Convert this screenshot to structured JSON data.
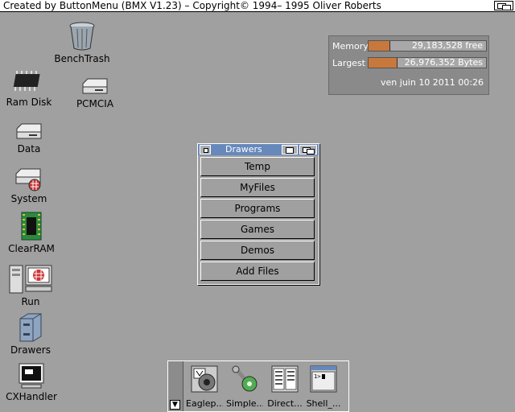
{
  "titlebar": {
    "text": "Created by ButtonMenu (BMX V1.23) – Copyright© 1994– 1995 Oliver Roberts"
  },
  "desktop_icons": [
    {
      "label": "BenchTrash",
      "icon": "trash-can-icon"
    },
    {
      "label": "Ram Disk",
      "icon": "ram-chip-icon"
    },
    {
      "label": "PCMCIA",
      "icon": "disk-drive-icon"
    },
    {
      "label": "Data",
      "icon": "disk-drive-icon"
    },
    {
      "label": "System",
      "icon": "system-drive-icon"
    },
    {
      "label": "ClearRAM",
      "icon": "green-chip-icon"
    },
    {
      "label": "Run",
      "icon": "computer-icon"
    },
    {
      "label": "Drawers",
      "icon": "cabinet-icon"
    },
    {
      "label": "CXHandler",
      "icon": "monitor-icon"
    }
  ],
  "memory": {
    "memory_label": "Memory",
    "memory_value": "29,183,528 free",
    "memory_used_fraction": 0.18,
    "largest_label": "Largest",
    "largest_value": "26,976,352 Bytes",
    "largest_used_fraction": 0.24,
    "date": "ven juin 10 2011 00:26"
  },
  "drawers_window": {
    "title": "Drawers",
    "buttons": [
      "Temp",
      "MyFiles",
      "Programs",
      "Games",
      "Demos",
      "Add Files"
    ]
  },
  "dock": {
    "items": [
      {
        "label": "Eaglep...",
        "icon": "eagleplayer-icon"
      },
      {
        "label": "Simple...",
        "icon": "simple-tool-icon"
      },
      {
        "label": "Direct...",
        "icon": "directory-icon"
      },
      {
        "label": "Shell_...",
        "icon": "shell-icon"
      }
    ]
  },
  "colors": {
    "desktop": "#a0a0a0",
    "window_title": "#6688bb",
    "memory_bar": "#c8783c"
  }
}
